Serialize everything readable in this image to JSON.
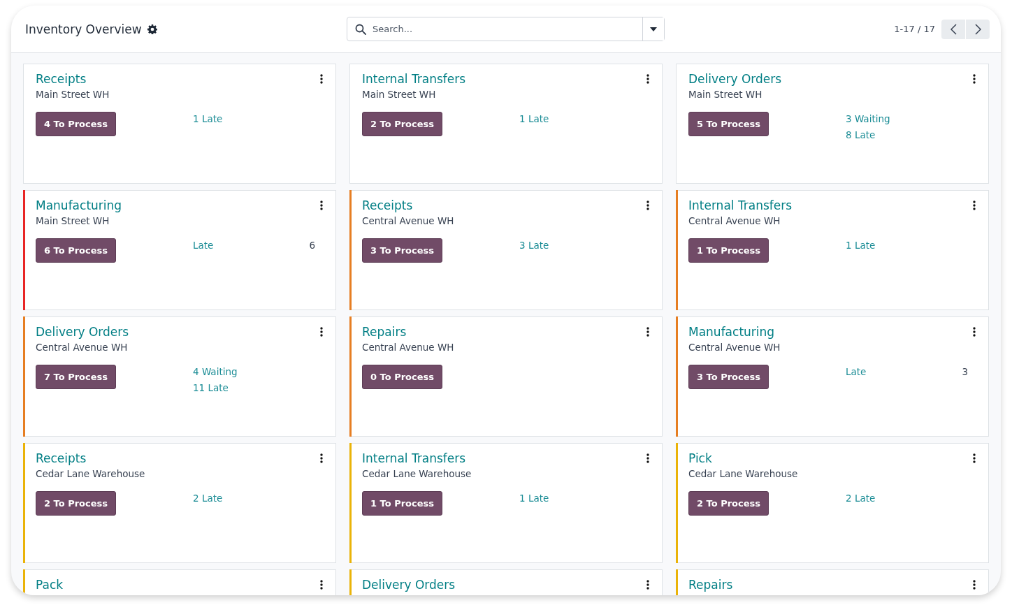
{
  "header": {
    "title": "Inventory Overview",
    "search": {
      "placeholder": "Search..."
    },
    "pager": "1-17 / 17"
  },
  "cards": [
    {
      "title": "Receipts",
      "subtitle": "Main Street WH",
      "button": "4 To Process",
      "stats": [
        {
          "label": "1 Late"
        }
      ]
    },
    {
      "title": "Internal Transfers",
      "subtitle": "Main Street WH",
      "button": "2 To Process",
      "stats": [
        {
          "label": "1 Late"
        }
      ]
    },
    {
      "title": "Delivery Orders",
      "subtitle": "Main Street WH",
      "button": "5 To Process",
      "stats": [
        {
          "label": "3 Waiting"
        },
        {
          "label": "8 Late"
        }
      ]
    },
    {
      "title": "Manufacturing",
      "subtitle": "Main Street WH",
      "button": "6 To Process",
      "color": "#e82525",
      "stats": [
        {
          "label": "Late",
          "value": "6"
        }
      ]
    },
    {
      "title": "Receipts",
      "subtitle": "Central Avenue WH",
      "button": "3 To Process",
      "color": "#e67e22",
      "stats": [
        {
          "label": "3 Late"
        }
      ]
    },
    {
      "title": "Internal Transfers",
      "subtitle": "Central Avenue WH",
      "button": "1 To Process",
      "color": "#e67e22",
      "stats": [
        {
          "label": "1 Late"
        }
      ]
    },
    {
      "title": "Delivery Orders",
      "subtitle": "Central Avenue WH",
      "button": "7 To Process",
      "color": "#e67e22",
      "stats": [
        {
          "label": "4 Waiting"
        },
        {
          "label": "11 Late"
        }
      ]
    },
    {
      "title": "Repairs",
      "subtitle": "Central Avenue WH",
      "button": "0 To Process",
      "color": "#e67e22"
    },
    {
      "title": "Manufacturing",
      "subtitle": "Central Avenue WH",
      "button": "3 To Process",
      "color": "#e67e22",
      "stats": [
        {
          "label": "Late",
          "value": "3"
        }
      ]
    },
    {
      "title": "Receipts",
      "subtitle": "Cedar Lane Warehouse",
      "button": "2 To Process",
      "color": "#eab308",
      "stats": [
        {
          "label": "2 Late"
        }
      ]
    },
    {
      "title": "Internal Transfers",
      "subtitle": "Cedar Lane Warehouse",
      "button": "1 To Process",
      "color": "#eab308",
      "stats": [
        {
          "label": "1 Late"
        }
      ]
    },
    {
      "title": "Pick",
      "subtitle": "Cedar Lane Warehouse",
      "button": "2 To Process",
      "color": "#eab308",
      "stats": [
        {
          "label": "2 Late"
        }
      ]
    },
    {
      "title": "Pack",
      "color": "#eab308"
    },
    {
      "title": "Delivery Orders",
      "color": "#eab308"
    },
    {
      "title": "Repairs",
      "color": "#eab308"
    }
  ]
}
